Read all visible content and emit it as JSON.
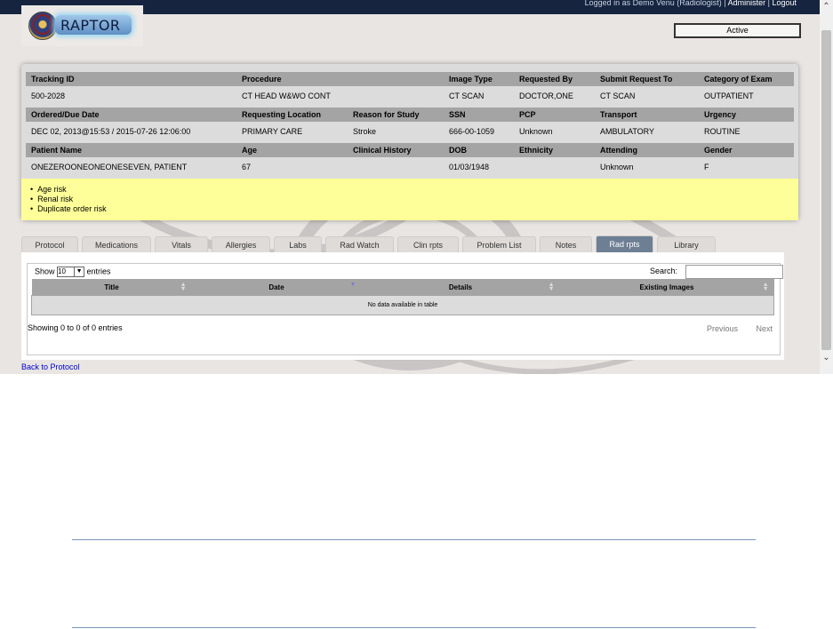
{
  "header": {
    "user_text": "Logged in as Demo Venu (Radiologist) |",
    "administer_label": "Administer",
    "separator": "|",
    "logout_label": "Logout",
    "logo_text": "RAPTOR",
    "status_value": "Active"
  },
  "info": {
    "rows": [
      {
        "headers": [
          "Tracking ID",
          "Procedure",
          "Image Type",
          "Requested By",
          "Submit Request To",
          "Category of Exam"
        ],
        "values": [
          "500-2028",
          "CT HEAD W&WO CONT",
          "CT SCAN",
          "DOCTOR,ONE",
          "CT SCAN",
          "OUTPATIENT"
        ]
      },
      {
        "headers": [
          "Ordered/Due Date",
          "Requesting Location",
          "Reason for Study",
          "SSN",
          "PCP",
          "Transport",
          "Urgency"
        ],
        "values": [
          "DEC 02, 2013@15:53 / 2015-07-26 12:06:00",
          "PRIMARY CARE",
          "Stroke",
          "666-00-1059",
          "Unknown",
          "AMBULATORY",
          "ROUTINE"
        ]
      },
      {
        "headers": [
          "Patient Name",
          "Age",
          "Clinical History",
          "DOB",
          "Ethnicity",
          "Attending",
          "Gender"
        ],
        "values": [
          "ONEZEROONEONEONESEVEN, PATIENT",
          "67",
          "",
          "01/03/1948",
          "",
          "Unknown",
          "F"
        ]
      }
    ],
    "risks": [
      "Age risk",
      "Renal risk",
      "Duplicate order risk"
    ]
  },
  "tabs": [
    "Protocol",
    "Medications",
    "Vitals",
    "Allergies",
    "Labs",
    "Rad Watch",
    "Clin rpts",
    "Problem List",
    "Notes",
    "Rad rpts",
    "Library"
  ],
  "active_tab": "Rad rpts",
  "table": {
    "show_label": "Show",
    "entries_value": "10",
    "entries_label": "entries",
    "search_label": "Search:",
    "search_value": "",
    "columns": [
      "Title",
      "Date",
      "Details",
      "Existing Images"
    ],
    "empty_message": "No data available in table",
    "info_text": "Showing 0 to 0 of 0 entries",
    "previous_label": "Previous",
    "next_label": "Next"
  },
  "back_link": "Back to Protocol",
  "colors": {
    "topbar": "#16243f",
    "header_row": "#a5a4a4",
    "risk_bg": "#ffff99",
    "active_tab": "#6e7f94",
    "link": "#0000cc"
  }
}
